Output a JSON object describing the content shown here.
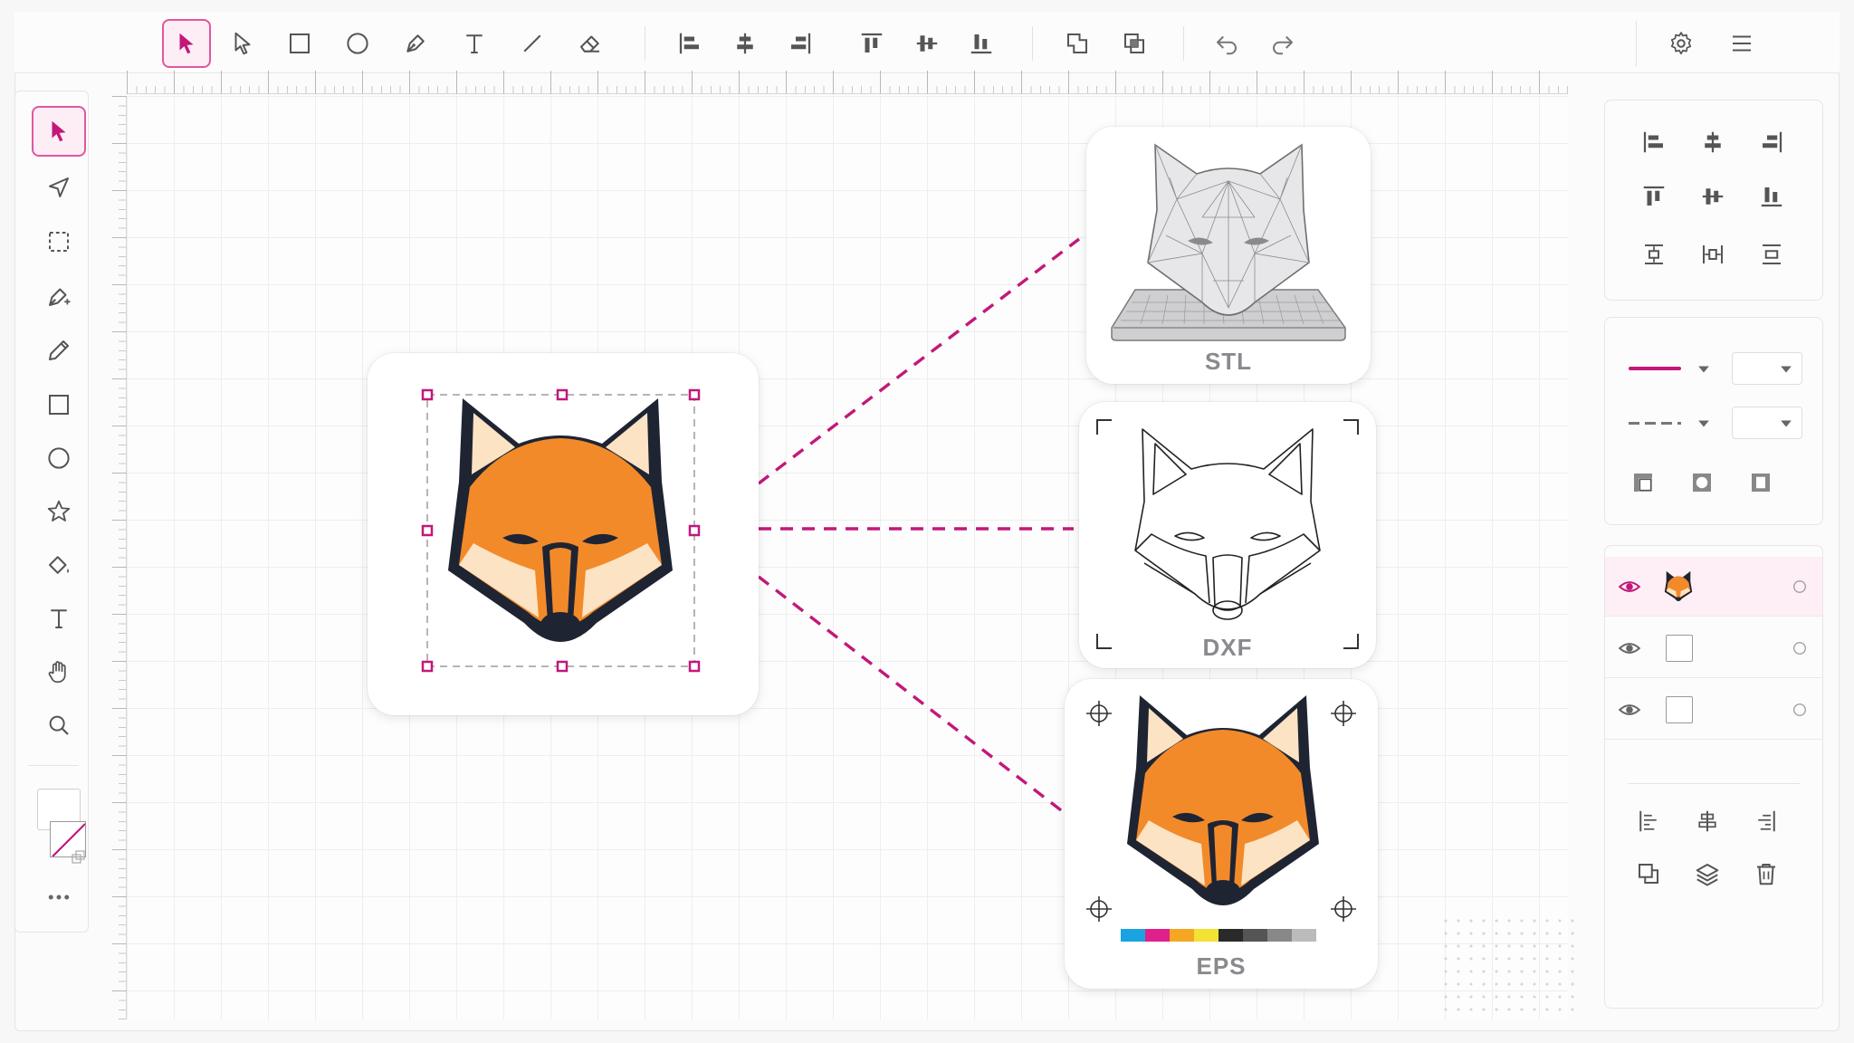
{
  "toolbar": {
    "tools": [
      "select-tool",
      "direct-select-tool",
      "rectangle-tool",
      "ellipse-tool",
      "pen-tool",
      "text-tool",
      "line-tool",
      "eraser-tool"
    ],
    "align": [
      "align-left",
      "align-center-horizontal",
      "align-right",
      "align-top",
      "align-middle-vertical",
      "align-bottom"
    ],
    "boolean": [
      "union",
      "intersect"
    ],
    "history": [
      "undo",
      "redo"
    ],
    "right": [
      "settings",
      "menu"
    ],
    "active_tool": "select-tool"
  },
  "left_tools": [
    "select",
    "direct-select",
    "marquee",
    "pen",
    "pencil",
    "rectangle",
    "ellipse",
    "star",
    "paint-bucket",
    "text",
    "hand",
    "zoom",
    "fill-stroke",
    "more"
  ],
  "canvas": {
    "source": {
      "name": "fox-logo"
    },
    "exports": [
      {
        "label": "STL",
        "kind": "3D wireframe"
      },
      {
        "label": "DXF",
        "kind": "outline"
      },
      {
        "label": "EPS",
        "kind": "print-ready color"
      }
    ]
  },
  "colors": {
    "accent": "#c2187a",
    "fox_orange": "#f28a2a",
    "fox_dark": "#1f2433",
    "fox_cream": "#fbe3c4",
    "cmyk_swatches": [
      "#1aa3e0",
      "#e0208a",
      "#f5a623",
      "#f2e233",
      "#2a2a2a",
      "#555555",
      "#888888",
      "#bbbbbb"
    ]
  },
  "right_panel": {
    "layers": [
      {
        "name": "fox-layer",
        "visible": true,
        "active": true
      },
      {
        "name": "empty-layer-1",
        "visible": true,
        "active": false
      },
      {
        "name": "empty-layer-2",
        "visible": true,
        "active": false
      }
    ]
  }
}
